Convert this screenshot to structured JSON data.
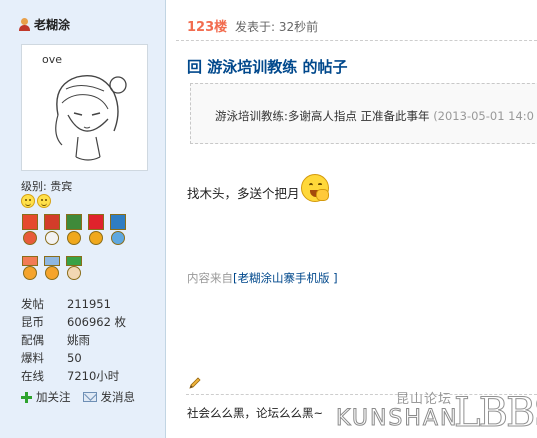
{
  "user": {
    "name": "老糊涂",
    "avatar_text": "ove",
    "level_label": "级别: 贵宾",
    "stats": [
      {
        "label": "发帖",
        "value": "211951"
      },
      {
        "label": "昆币",
        "value": "606962 枚"
      },
      {
        "label": "配偶",
        "value": "姚雨"
      },
      {
        "label": "爆料",
        "value": "50"
      },
      {
        "label": "在线",
        "value": "7210小时"
      }
    ],
    "actions": {
      "follow": "加关注",
      "message": "发消息"
    }
  },
  "post": {
    "floor": "123楼",
    "posted": "发表于: 32秒前",
    "title": "回 游泳培训教练 的帖子",
    "quote_text": "游泳培训教练:多谢高人指点 正准备此事年",
    "quote_date": "(2013-05-01 14:0",
    "body": "找木头，多送个把月",
    "source_prefix": "内容来自",
    "source_link": "[老糊涂山寨手机版 ]",
    "signature": "社会么么黑，论坛么么黑~"
  },
  "watermark": {
    "cn": "昆山论坛",
    "en": "KUNSHAN",
    "bbs": "LBBS"
  },
  "colors": {
    "title": "#00488c",
    "floor": "#f26c4f",
    "sidebar_bg": "#e6effa"
  },
  "icons": [
    "user-icon",
    "smiley-icon",
    "medal-icon",
    "plus-icon",
    "mail-icon",
    "grin-icon",
    "pencil-icon"
  ]
}
